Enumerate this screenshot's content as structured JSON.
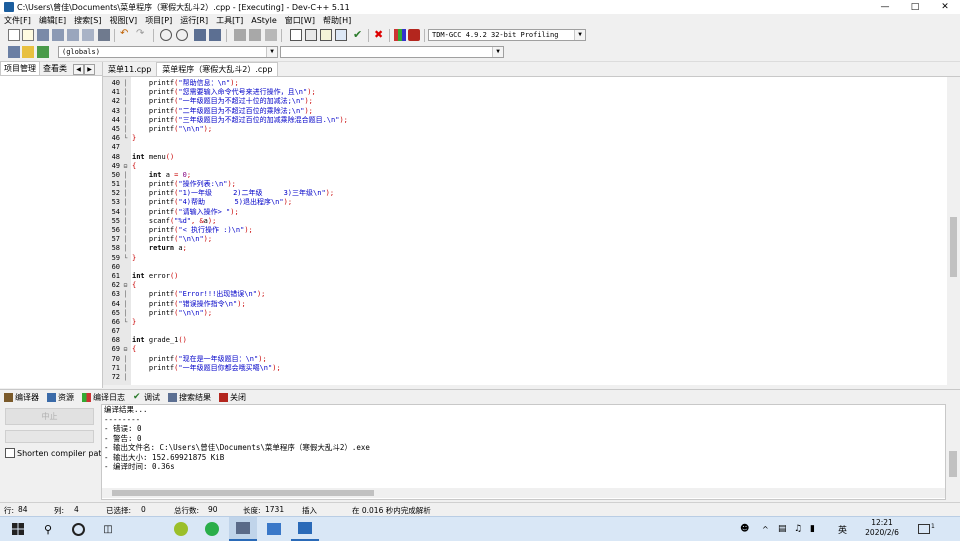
{
  "window": {
    "title": "C:\\Users\\曾佳\\Documents\\菜单程序（寒假大乱斗2）.cpp - [Executing] - Dev-C++ 5.11",
    "controls": [
      "minimize-icon",
      "maximize-icon",
      "close-icon"
    ]
  },
  "menu": [
    "文件[F]",
    "编辑[E]",
    "搜索[S]",
    "视图[V]",
    "项目[P]",
    "运行[R]",
    "工具[T]",
    "AStyle",
    "窗口[W]",
    "帮助[H]"
  ],
  "toolbar": {
    "compiler": "TDM-GCC 4.9.2 32-bit Profiling",
    "scope": "(globals)",
    "member": ""
  },
  "left_panel": {
    "tabs": [
      "项目管理",
      "查看类"
    ]
  },
  "editor": {
    "tabs": [
      "菜单11.cpp",
      "菜单程序（寒假大乱斗2）.cpp"
    ],
    "active_tab": 1,
    "lines": [
      {
        "n": "40",
        "fold": "│",
        "code": "    printf(\"帮助信息：\\n\");"
      },
      {
        "n": "41",
        "fold": "│",
        "code": "    printf(\"您需要输入命令代号来进行操作，且\\n\");"
      },
      {
        "n": "42",
        "fold": "│",
        "code": "    printf(\"一年级题目为不超过十位的加减法;\\n\");"
      },
      {
        "n": "43",
        "fold": "│",
        "code": "    printf(\"二年级题目为不超过百位的乘除法;\\n\");"
      },
      {
        "n": "44",
        "fold": "│",
        "code": "    printf(\"三年级题目为不超过百位的加减乘除混合题目.\\n\");"
      },
      {
        "n": "45",
        "fold": "│",
        "code": "    printf(\"\\n\\n\");"
      },
      {
        "n": "46",
        "fold": "└",
        "code": "}"
      },
      {
        "n": "47",
        "fold": "",
        "code": ""
      },
      {
        "n": "48",
        "fold": "",
        "code": "int menu()"
      },
      {
        "n": "49",
        "fold": "⊟",
        "code": "{"
      },
      {
        "n": "50",
        "fold": "│",
        "code": "    int a = 0;"
      },
      {
        "n": "51",
        "fold": "│",
        "code": "    printf(\"操作列表:\\n\");"
      },
      {
        "n": "52",
        "fold": "│",
        "code": "    printf(\"1)一年级     2)二年级     3)三年级\\n\");"
      },
      {
        "n": "53",
        "fold": "│",
        "code": "    printf(\"4)帮助       5)退出程序\\n\");"
      },
      {
        "n": "54",
        "fold": "│",
        "code": "    printf(\"请输入操作> \");"
      },
      {
        "n": "55",
        "fold": "│",
        "code": "    scanf(\"%d\", &a);"
      },
      {
        "n": "56",
        "fold": "│",
        "code": "    printf(\"< 执行操作 :)\\n\");"
      },
      {
        "n": "57",
        "fold": "│",
        "code": "    printf(\"\\n\\n\");"
      },
      {
        "n": "58",
        "fold": "│",
        "code": "    return a;"
      },
      {
        "n": "59",
        "fold": "└",
        "code": "}"
      },
      {
        "n": "60",
        "fold": "",
        "code": ""
      },
      {
        "n": "61",
        "fold": "",
        "code": "int error()"
      },
      {
        "n": "62",
        "fold": "⊟",
        "code": "{"
      },
      {
        "n": "63",
        "fold": "│",
        "code": "    printf(\"Error!!!出现错误\\n\");"
      },
      {
        "n": "64",
        "fold": "│",
        "code": "    printf(\"错误操作指令\\n\");"
      },
      {
        "n": "65",
        "fold": "│",
        "code": "    printf(\"\\n\\n\");"
      },
      {
        "n": "66",
        "fold": "└",
        "code": "}"
      },
      {
        "n": "67",
        "fold": "",
        "code": ""
      },
      {
        "n": "68",
        "fold": "",
        "code": "int grade_1()"
      },
      {
        "n": "69",
        "fold": "⊟",
        "code": "{"
      },
      {
        "n": "70",
        "fold": "│",
        "code": "    printf(\"现在是一年级题目：\\n\");"
      },
      {
        "n": "71",
        "fold": "│",
        "code": "    printf(\"一年级题目你都会哦买噶\\n\");"
      },
      {
        "n": "72",
        "fold": "│",
        "code": ""
      }
    ]
  },
  "bottom_tabs": [
    "编译器",
    "资源",
    "编译日志",
    "调试",
    "搜索结果",
    "关闭"
  ],
  "compile_panel": {
    "button": "中止",
    "shorten_label": "Shorten compiler paths"
  },
  "output_lines": [
    "编译结果...",
    "--------",
    "- 错误: 0",
    "- 警告: 0",
    "- 输出文件名: C:\\Users\\曾佳\\Documents\\菜单程序（寒假大乱斗2）.exe",
    "- 输出大小: 152.69921875 KiB",
    "- 编译时间: 0.36s"
  ],
  "status": {
    "row_label": "行:",
    "row": "84",
    "col_label": "列:",
    "col": "4",
    "sel_label": "已选择:",
    "sel": "0",
    "total_label": "总行数:",
    "total": "90",
    "len_label": "长度:",
    "len": "1731",
    "mode": "插入",
    "parse": "在 0.016 秒内完成解析"
  },
  "taskbar": {
    "time": "12:21",
    "date": "2020/2/6",
    "ime": "英",
    "notification_count": "1"
  }
}
